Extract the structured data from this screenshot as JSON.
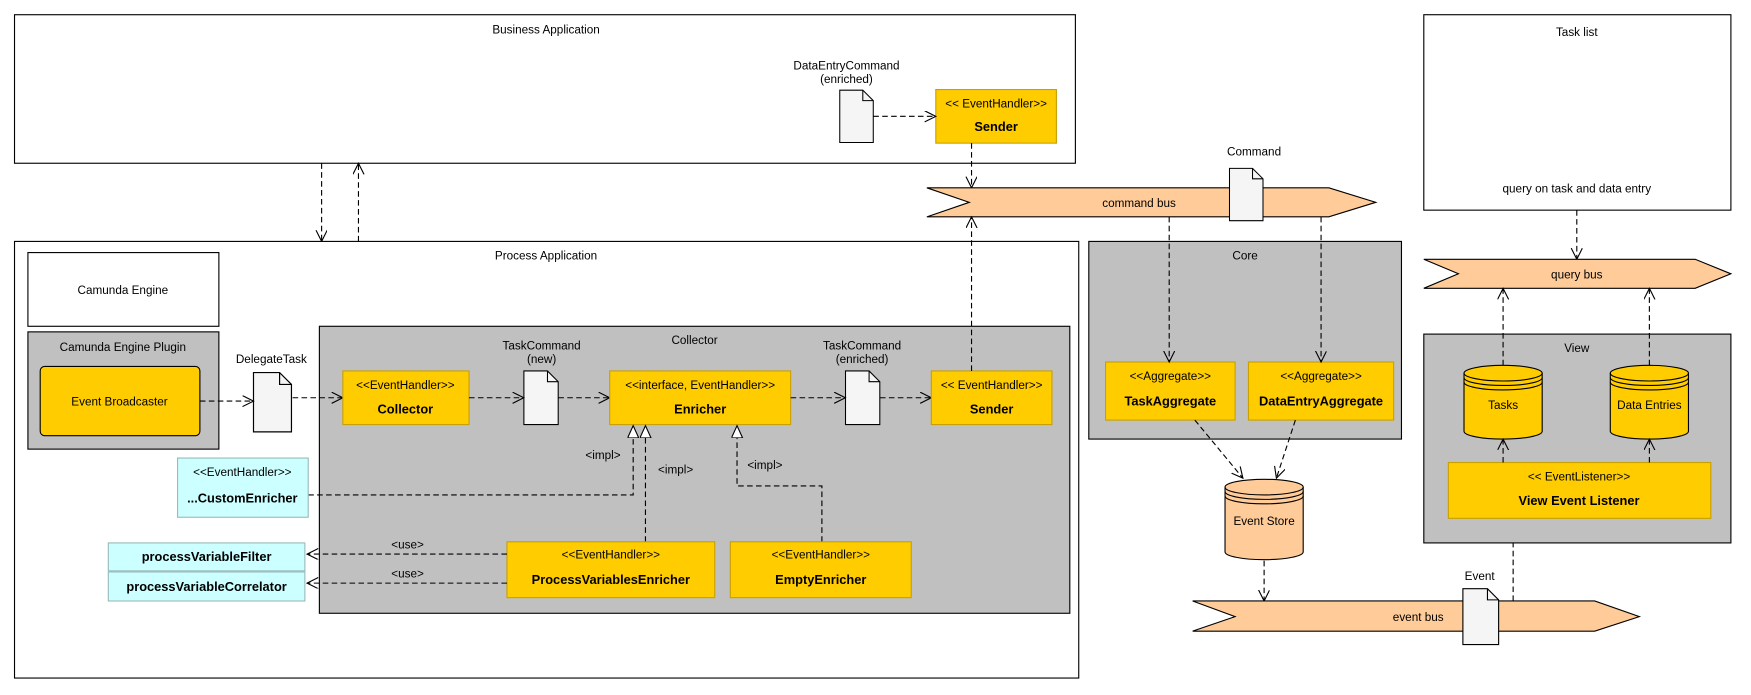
{
  "business_app": {
    "title": "Business Application",
    "command_label_1": "DataEntryCommand",
    "command_label_2": "(enriched)",
    "sender": {
      "stereotype": "<< EventHandler>>",
      "name": "Sender"
    }
  },
  "command_bus": {
    "label": "command bus",
    "message": "Command"
  },
  "process_app": {
    "title": "Process Application",
    "camunda_engine": "Camunda Engine",
    "plugin": {
      "title": "Camunda Engine Plugin",
      "broadcaster": "Event Broadcaster"
    },
    "delegate_task": "DelegateTask",
    "collector_group": {
      "title": "Collector",
      "collector": {
        "stereotype": "<<EventHandler>>",
        "name": "Collector"
      },
      "task_command_new": [
        "TaskCommand",
        "(new)"
      ],
      "enricher": {
        "stereotype": "<<interface, EventHandler>>",
        "name": "Enricher"
      },
      "task_command_enriched": [
        "TaskCommand",
        "(enriched)"
      ],
      "sender": {
        "stereotype": "<< EventHandler>>",
        "name": "Sender"
      },
      "process_variables_enricher": {
        "stereotype": "<<EventHandler>>",
        "name": "ProcessVariablesEnricher"
      },
      "empty_enricher": {
        "stereotype": "<<EventHandler>>",
        "name": "EmptyEnricher"
      },
      "impl_labels": [
        "<impl>",
        "<impl>",
        "<impl>"
      ]
    },
    "custom_enricher": {
      "stereotype": "<<EventHandler>>",
      "name": "...CustomEnricher"
    },
    "process_variable_filter": "processVariableFilter",
    "process_variable_correlator": "processVariableCorrelator",
    "use_labels": [
      "<use>",
      "<use>"
    ]
  },
  "core": {
    "title": "Core",
    "task_aggregate": {
      "stereotype": "<<Aggregate>>",
      "name": "TaskAggregate"
    },
    "data_entry_aggregate": {
      "stereotype": "<<Aggregate>>",
      "name": "DataEntryAggregate"
    }
  },
  "event_store": "Event Store",
  "event_bus": {
    "label": "event bus",
    "message": "Event"
  },
  "task_list": {
    "title": "Task list",
    "note": "query on task and data entry"
  },
  "query_bus": {
    "label": "query bus"
  },
  "view": {
    "title": "View",
    "tasks": "Tasks",
    "data_entries": "Data Entries",
    "listener": {
      "stereotype": "<< EventListener>>",
      "name": "View Event Listener"
    }
  },
  "colors": {
    "component": "#ffcc00",
    "group": "#c0c0c0",
    "bus": "#ffcc99",
    "helper": "#ccffff"
  }
}
